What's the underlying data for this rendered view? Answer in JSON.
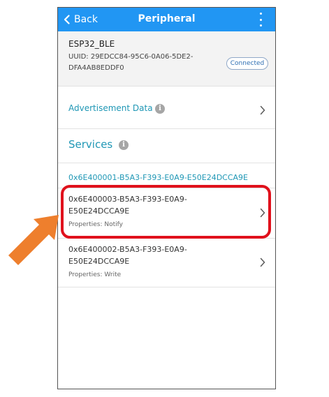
{
  "navbar": {
    "back_label": "Back",
    "title": "Peripheral",
    "menu_icon": "more-vert-icon"
  },
  "device": {
    "name": "ESP32_BLE",
    "uuid_line1": "UUID: 29EDCC84-95C6-0A06-5DE2-",
    "uuid_line2": "DFA4AB8EDDF0",
    "status": "Connected"
  },
  "advertisement": {
    "label": "Advertisement Data",
    "info_icon": "info-icon",
    "chevron_icon": "chevron-right-icon"
  },
  "services": {
    "title": "Services",
    "info_icon": "info-icon",
    "service_uuid": "0x6E400001-B5A3-F393-E0A9-E50E24DCCA9E",
    "characteristics": [
      {
        "uuid_line1": "0x6E400003-B5A3-F393-E0A9-",
        "uuid_line2": "E50E24DCCA9E",
        "properties": "Properties: Notify"
      },
      {
        "uuid_line1": "0x6E400002-B5A3-F393-E0A9-",
        "uuid_line2": "E50E24DCCA9E",
        "properties": "Properties: Write"
      }
    ]
  },
  "colors": {
    "navbar": "#2196f3",
    "accent_teal": "#1f97b5",
    "highlight_red": "#e0111c",
    "arrow_orange": "#ee7f2d"
  }
}
